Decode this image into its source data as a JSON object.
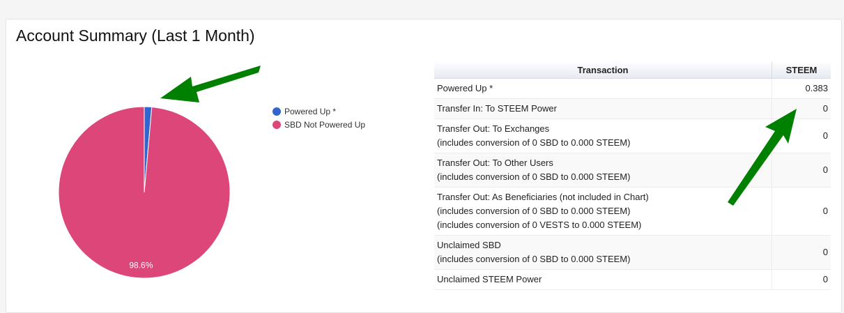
{
  "title": "Account Summary (Last 1 Month)",
  "colors": {
    "powered_up": "#3366cc",
    "sbd_not_powered_up": "#dc4679",
    "arrow": "#008000"
  },
  "chart_data": {
    "type": "pie",
    "slices": [
      {
        "name": "Powered Up *",
        "value": 1.4,
        "color": "#3366cc"
      },
      {
        "name": "SBD Not Powered Up",
        "value": 98.6,
        "color": "#dc4679",
        "label": "98.6%"
      }
    ],
    "legend": "right"
  },
  "table": {
    "headers": [
      "Transaction",
      "STEEM"
    ],
    "rows": [
      {
        "lines": [
          "Powered Up *"
        ],
        "value": "0.383"
      },
      {
        "lines": [
          "Transfer In: To STEEM Power"
        ],
        "value": "0"
      },
      {
        "lines": [
          "Transfer Out: To Exchanges",
          "(includes conversion of 0 SBD to 0.000 STEEM)"
        ],
        "value": "0"
      },
      {
        "lines": [
          "Transfer Out: To Other Users",
          "(includes conversion of 0 SBD to 0.000 STEEM)"
        ],
        "value": "0"
      },
      {
        "lines": [
          "Transfer Out: As Beneficiaries (not included in Chart)",
          "(includes conversion of 0 SBD to 0.000 STEEM)",
          "(includes conversion of 0 VESTS to 0.000 STEEM)"
        ],
        "value": "0"
      },
      {
        "lines": [
          "Unclaimed SBD",
          "(includes conversion of 0 SBD to 0.000 STEEM)"
        ],
        "value": "0"
      },
      {
        "lines": [
          "Unclaimed STEEM Power"
        ],
        "value": "0"
      }
    ]
  }
}
